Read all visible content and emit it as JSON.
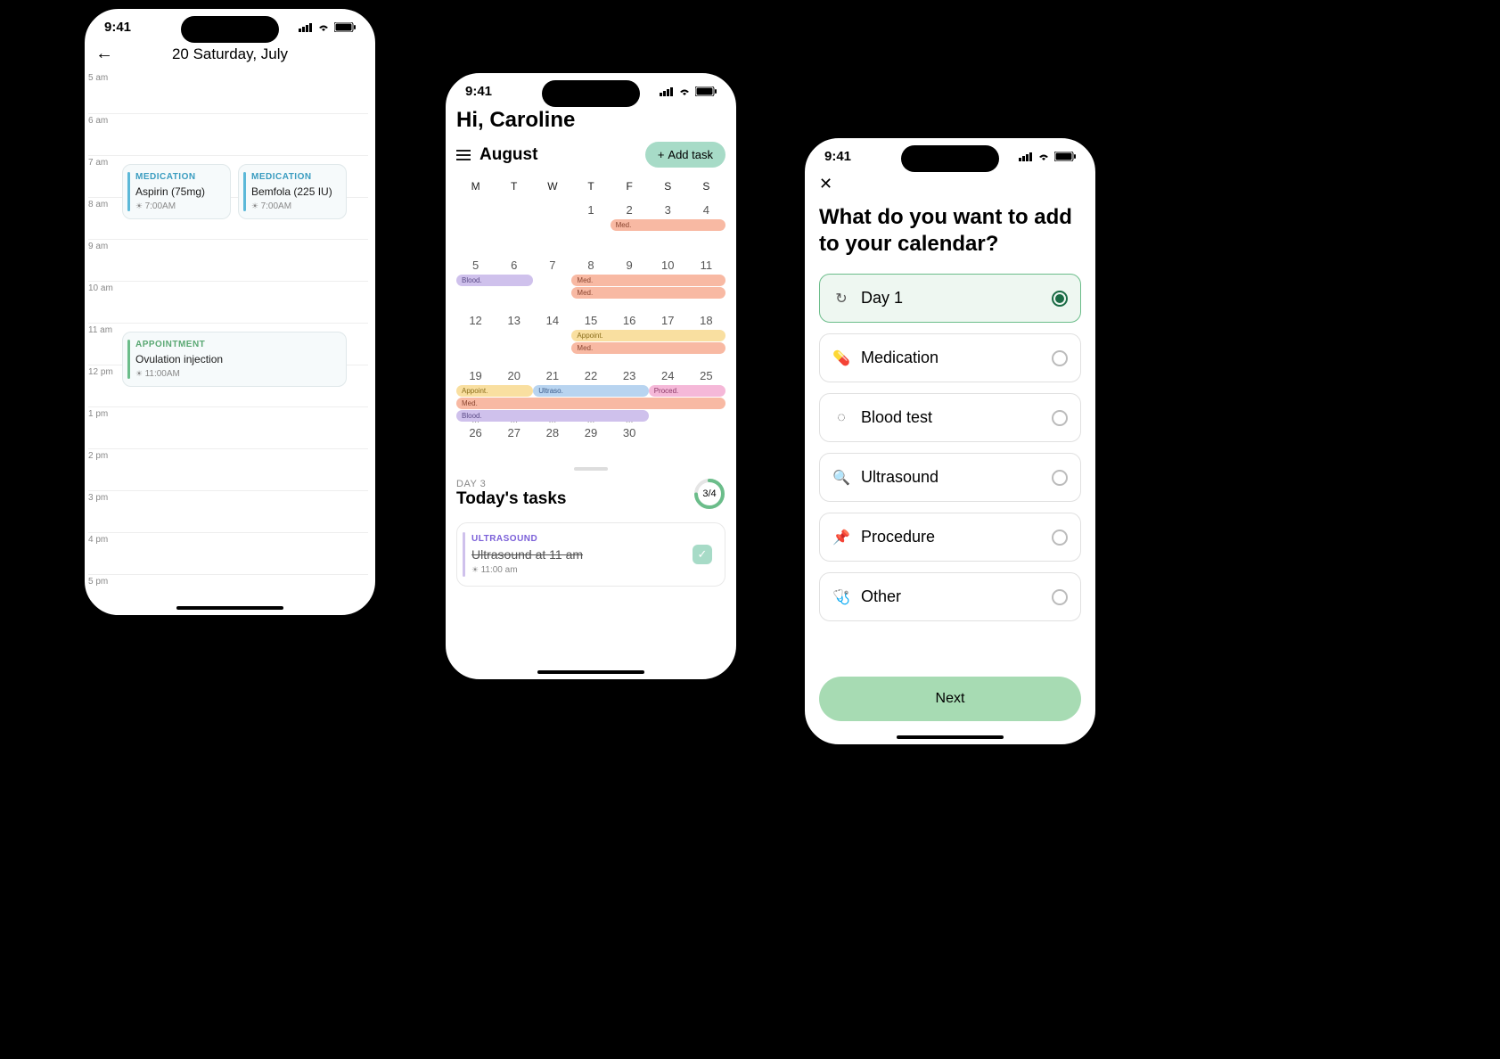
{
  "status": {
    "time": "9:41"
  },
  "phone1": {
    "title": "20 Saturday, July",
    "hours": [
      "5 am",
      "6 am",
      "7 am",
      "8 am",
      "9 am",
      "10 am",
      "11 am",
      "12 pm",
      "1 pm",
      "2 pm",
      "3 pm",
      "4 pm",
      "5 pm"
    ],
    "events": [
      {
        "tag": "MEDICATION",
        "title": "Aspirin (75mg)",
        "time": "7:00AM"
      },
      {
        "tag": "MEDICATION",
        "title": "Bemfola (225 IU)",
        "time": "7:00AM"
      },
      {
        "tag": "APPOINTMENT",
        "title": "Ovulation injection",
        "time": "11:00AM"
      }
    ]
  },
  "phone2": {
    "greeting": "Hi, Caroline",
    "month": "August",
    "add_task": "Add task",
    "dow": [
      "M",
      "T",
      "W",
      "T",
      "F",
      "S",
      "S"
    ],
    "weeks": [
      [
        "",
        "",
        "",
        "1",
        "2",
        "3",
        "4"
      ],
      [
        "5",
        "6",
        "7",
        "8",
        "9",
        "10",
        "11"
      ],
      [
        "12",
        "13",
        "14",
        "15",
        "16",
        "17",
        "18"
      ],
      [
        "19",
        "20",
        "21",
        "22",
        "23",
        "24",
        "25"
      ],
      [
        "26",
        "27",
        "28",
        "29",
        "30",
        "",
        ""
      ]
    ],
    "bars": {
      "w0": [
        {
          "label": "Med.",
          "cls": "bar-med"
        }
      ],
      "w1": [
        {
          "label": "Blood.",
          "cls": "bar-blood"
        },
        {
          "label": "Med.",
          "cls": "bar-med"
        },
        {
          "label": "Med.",
          "cls": "bar-med"
        }
      ],
      "w2": [
        {
          "label": "Appoint.",
          "cls": "bar-appt"
        },
        {
          "label": "Med.",
          "cls": "bar-med"
        }
      ],
      "w3": [
        {
          "label": "Appoint.",
          "cls": "bar-appt"
        },
        {
          "label": "Ultraso.",
          "cls": "bar-ultra"
        },
        {
          "label": "Proced.",
          "cls": "bar-proc"
        },
        {
          "label": "Med.",
          "cls": "bar-med"
        },
        {
          "label": "Blood.",
          "cls": "bar-blood"
        }
      ]
    },
    "day_label": "DAY 3",
    "tasks_title": "Today's tasks",
    "progress": "3/4",
    "task": {
      "tag": "ULTRASOUND",
      "title": "Ultrasound at 11 am",
      "time": "11:00 am"
    }
  },
  "phone3": {
    "title": "What do you want to add to your calendar?",
    "options": [
      {
        "icon": "↻",
        "label": "Day 1",
        "selected": true
      },
      {
        "icon": "💊",
        "label": "Medication",
        "selected": false
      },
      {
        "icon": "◌",
        "label": "Blood test",
        "selected": false
      },
      {
        "icon": "🔍",
        "label": "Ultrasound",
        "selected": false
      },
      {
        "icon": "📌",
        "label": "Procedure",
        "selected": false
      },
      {
        "icon": "🩺",
        "label": "Other",
        "selected": false
      }
    ],
    "next": "Next"
  }
}
